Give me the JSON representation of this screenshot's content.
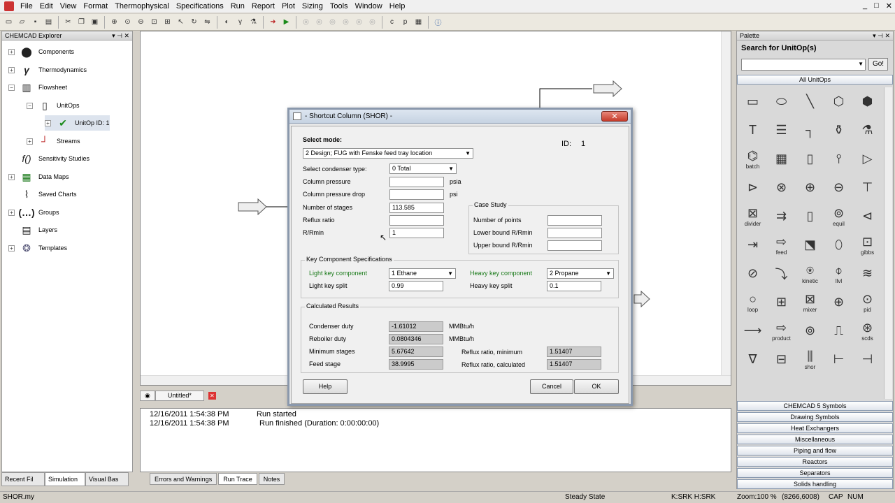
{
  "menu": {
    "items": [
      "File",
      "Edit",
      "View",
      "Format",
      "Thermophysical",
      "Specifications",
      "Run",
      "Report",
      "Plot",
      "Sizing",
      "Tools",
      "Window",
      "Help"
    ]
  },
  "window_controls": [
    "_",
    "□",
    "✕"
  ],
  "explorer": {
    "title": "CHEMCAD Explorer",
    "items": [
      {
        "label": "Components"
      },
      {
        "label": "Thermodynamics"
      },
      {
        "label": "Flowsheet"
      },
      {
        "label": "UnitOps"
      },
      {
        "label": "UnitOp ID: 1"
      },
      {
        "label": "Streams"
      },
      {
        "label": "Sensitivity Studies"
      },
      {
        "label": "Data Maps"
      },
      {
        "label": "Saved Charts"
      },
      {
        "label": "Groups"
      },
      {
        "label": "Layers"
      },
      {
        "label": "Templates"
      }
    ],
    "bottom_tabs": [
      "Recent Fil",
      "Simulation",
      "Visual Bas"
    ]
  },
  "document": {
    "tab": "Untitled*"
  },
  "output": {
    "log": [
      {
        "time": "12/16/2011 1:54:38 PM",
        "msg": "Run started"
      },
      {
        "time": "12/16/2011 1:54:38 PM",
        "msg": "Run finished (Duration: 0:00:00:00)"
      }
    ],
    "tabs": [
      "Errors and Warnings",
      "Run Trace",
      "Notes"
    ]
  },
  "palette": {
    "title": "Palette",
    "search_label": "Search for UnitOp(s)",
    "search_value": "",
    "go_label": "Go!",
    "all_header": "All UnitOps",
    "cell_labels": [
      "",
      "",
      "",
      "",
      "",
      "",
      "",
      "",
      "",
      "",
      "batch",
      "",
      "",
      "",
      "",
      "",
      "",
      "",
      "",
      "",
      "divider",
      "",
      "",
      "equil",
      "",
      "",
      "feed",
      "",
      "",
      "gibbs",
      "",
      "",
      "kinetic",
      "llvl",
      "",
      "loop",
      "",
      "mixer",
      "",
      "pid",
      "",
      "product",
      "",
      "",
      "scds",
      "",
      "",
      "shor",
      "",
      ""
    ],
    "sections": [
      "CHEMCAD 5 Symbols",
      "Drawing Symbols",
      "Heat Exchangers",
      "Miscellaneous",
      "Piping and flow",
      "Reactors",
      "Separators",
      "Solids handling"
    ]
  },
  "status": {
    "file": "SHOR.my",
    "state": "Steady State",
    "thermo": "K:SRK H:SRK",
    "zoom": "Zoom:100 %",
    "coords": "(8266,6008)",
    "caps": "CAP",
    "num": "NUM"
  },
  "dialog": {
    "title": "- Shortcut Column (SHOR) -",
    "close": "✕",
    "select_mode_label": "Select mode:",
    "mode_value": "2 Design; FUG with Fenske feed tray location",
    "id_label": "ID:",
    "id_value": "1",
    "condenser_label": "Select condenser type:",
    "condenser_value": "0 Total",
    "pressure_label": "Column pressure",
    "pressure_value": "",
    "pressure_unit": "psia",
    "pdrop_label": "Column pressure drop",
    "pdrop_value": "",
    "pdrop_unit": "psi",
    "stages_label": "Number of stages",
    "stages_value": "113.585",
    "reflux_label": "Reflux ratio",
    "reflux_value": "",
    "rrmin_label": "R/Rmin",
    "rrmin_value": "1",
    "case_study": {
      "title": "Case Study",
      "points_label": "Number of points",
      "points_value": "",
      "lower_label": "Lower bound R/Rmin",
      "lower_value": "",
      "upper_label": "Upper bound R/Rmin",
      "upper_value": ""
    },
    "keys": {
      "title": "Key Component Specifications",
      "light_label": "Light key component",
      "light_value": "1 Ethane",
      "heavy_label": "Heavy key component",
      "heavy_value": "2 Propane",
      "light_split_label": "Light key split",
      "light_split_value": "0.99",
      "heavy_split_label": "Heavy key split",
      "heavy_split_value": "0.1"
    },
    "results": {
      "title": "Calculated Results",
      "cond_label": "Condenser duty",
      "cond_value": "-1.61012",
      "cond_unit": "MMBtu/h",
      "reb_label": "Reboiler duty",
      "reb_value": "0.0804346",
      "reb_unit": "MMBtu/h",
      "min_label": "Minimum stages",
      "min_value": "5.67642",
      "feed_label": "Feed stage",
      "feed_value": "38.9995",
      "rmin_label": "Reflux ratio, minimum",
      "rmin_value": "1.51407",
      "rcalc_label": "Reflux ratio, calculated",
      "rcalc_value": "1.51407"
    },
    "help": "Help",
    "cancel": "Cancel",
    "ok": "OK"
  }
}
